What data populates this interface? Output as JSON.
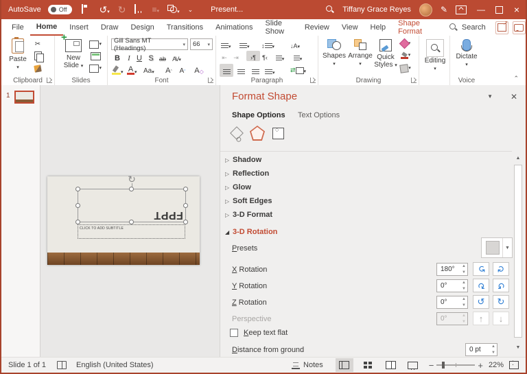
{
  "titlebar": {
    "autosave_label": "AutoSave",
    "autosave_state": "Off",
    "title": "Present...",
    "user_name": "Tiffany Grace Reyes"
  },
  "ribbon_tabs": {
    "items": [
      {
        "label": "File"
      },
      {
        "label": "Home"
      },
      {
        "label": "Insert"
      },
      {
        "label": "Draw"
      },
      {
        "label": "Design"
      },
      {
        "label": "Transitions"
      },
      {
        "label": "Animations"
      },
      {
        "label": "Slide Show"
      },
      {
        "label": "Review"
      },
      {
        "label": "View"
      },
      {
        "label": "Help"
      },
      {
        "label": "Shape Format"
      }
    ],
    "search_label": "Search"
  },
  "ribbon": {
    "clipboard": {
      "paste_label": "Paste",
      "group_label": "Clipboard"
    },
    "slides": {
      "new_slide_line1": "New",
      "new_slide_line2": "Slide",
      "group_label": "Slides"
    },
    "font": {
      "name": "Gill Sans MT (Headings)",
      "size": "66",
      "bold": "B",
      "italic": "I",
      "underline": "U",
      "shadow": "S",
      "strike": "ab",
      "spacing": "AV",
      "case": "Aa",
      "grow": "A",
      "shrink": "A",
      "clear": "A",
      "group_label": "Font"
    },
    "paragraph": {
      "ltr": "›¶",
      "rtl": "¶‹",
      "group_label": "Paragraph"
    },
    "drawing": {
      "shapes_label": "Shapes",
      "arrange_label": "Arrange",
      "quick_styles_line1": "Quick",
      "quick_styles_line2": "Styles",
      "group_label": "Drawing"
    },
    "editing": {
      "label": "Editing"
    },
    "voice": {
      "dictate_label": "Dictate",
      "group_label": "Voice"
    }
  },
  "slide_pane": {
    "slide_number": "1"
  },
  "slide": {
    "title_text": "FPPT",
    "subtitle_placeholder": "CLICK TO ADD SUBTITLE"
  },
  "panel": {
    "title": "Format Shape",
    "tabs": [
      {
        "label": "Shape Options"
      },
      {
        "label": "Text Options"
      }
    ],
    "sections": [
      {
        "label": "Shadow",
        "state": "collapsed"
      },
      {
        "label": "Reflection",
        "state": "collapsed"
      },
      {
        "label": "Glow",
        "state": "collapsed"
      },
      {
        "label": "Soft Edges",
        "state": "collapsed"
      },
      {
        "label": "3-D Format",
        "state": "collapsed"
      },
      {
        "label": "3-D Rotation",
        "state": "expanded"
      }
    ],
    "presets_label": "Presets",
    "rotation_rows": [
      {
        "label": "X Rotation",
        "value": "180°"
      },
      {
        "label": "Y Rotation",
        "value": "0°"
      },
      {
        "label": "Z Rotation",
        "value": "0°"
      }
    ],
    "perspective": {
      "label": "Perspective",
      "value": "0°"
    },
    "keep_text_flat_label": "Keep text flat",
    "distance_label": "Distance from ground",
    "distance_value": "0 pt",
    "accent_color": "#c24b33",
    "rotate_icon_color": "#2b7cd3"
  },
  "statusbar": {
    "slide_info": "Slide 1 of 1",
    "language": "English (United States)",
    "notes_label": "Notes",
    "zoom_percent": "22%"
  }
}
